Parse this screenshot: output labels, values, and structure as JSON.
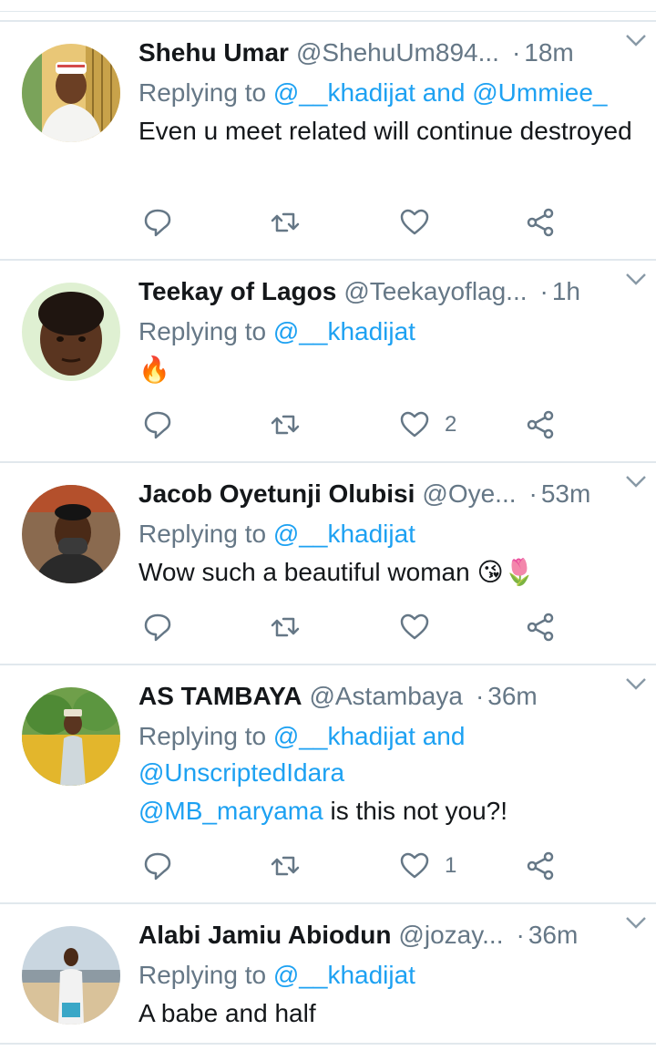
{
  "tweets": [
    {
      "name": "Shehu Umar",
      "handle": "@ShehuUm894...",
      "dot": "·",
      "time": "18m",
      "replying_prefix": "Replying to",
      "replying_to": "@__khadijat and @Ummiee_",
      "text": "Even u meet related will continue destroyed",
      "likes": ""
    },
    {
      "name": "Teekay of Lagos",
      "handle": "@Teekayoflag...",
      "dot": "·",
      "time": "1h",
      "replying_prefix": "Replying to",
      "replying_to": "@__khadijat",
      "text": "🔥",
      "likes": "2"
    },
    {
      "name": "Jacob Oyetunji Olubisi",
      "handle": "@Oye...",
      "dot": "·",
      "time": "53m",
      "replying_prefix": "Replying to",
      "replying_to": "@__khadijat",
      "text": "Wow such a beautiful woman 😘🌷",
      "likes": ""
    },
    {
      "name": "AS TAMBAYA",
      "handle": "@Astambaya",
      "dot": "·",
      "time": "36m",
      "replying_prefix": "Replying to",
      "replying_to": "@__khadijat and @UnscriptedIdara",
      "text_mention": "@MB_maryama",
      "text": " is this not you?!",
      "likes": "1"
    },
    {
      "name": "Alabi Jamiu Abiodun",
      "handle": "@jozay...",
      "dot": "·",
      "time": "36m",
      "replying_prefix": "Replying to",
      "replying_to": "@__khadijat",
      "text": "A babe and half",
      "likes": ""
    }
  ],
  "colors": {
    "accent": "#1da1f2",
    "secondary_text": "#657786",
    "primary_text": "#14171a",
    "divider": "#e1e8ed"
  },
  "icons": [
    "reply-icon",
    "retweet-icon",
    "like-icon",
    "share-icon",
    "chevron-down-icon"
  ]
}
